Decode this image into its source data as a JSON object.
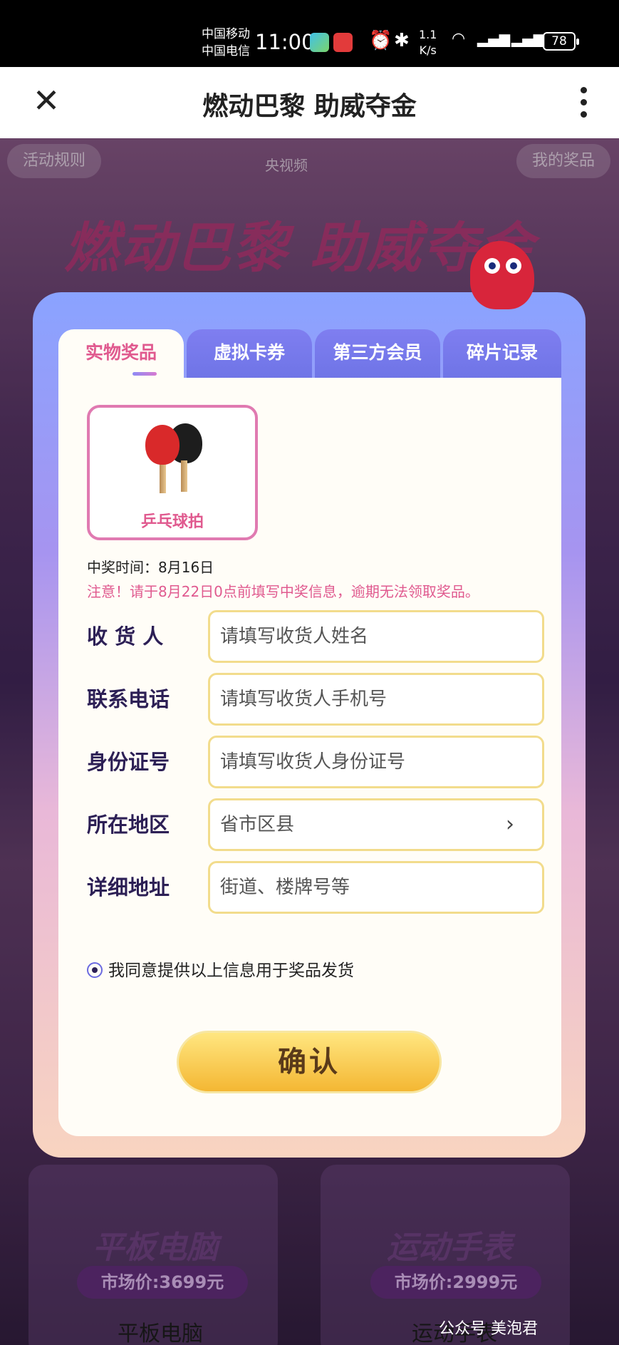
{
  "status_bar": {
    "carrier_1": "中国移动",
    "carrier_2": "中国电信",
    "time": "11:00",
    "net_speed_value": "1.1",
    "net_speed_unit": "K/s",
    "battery": "78",
    "icons": [
      "alarm-icon",
      "bluetooth-icon",
      "wifi-icon",
      "signal-icon"
    ]
  },
  "title_bar": {
    "title": "燃动巴黎 助威夺金"
  },
  "background": {
    "rules_link": "活动规则",
    "my_prizes_link": "我的奖品",
    "logo_text": "央视频",
    "headline": "燃动巴黎 助威夺金",
    "items": [
      {
        "name": "平板电脑",
        "price": "市场价:3699元",
        "caption": "平板电脑"
      },
      {
        "name": "运动手表",
        "price": "市场价:2999元",
        "caption": "运动手表"
      }
    ]
  },
  "modal": {
    "tabs": [
      {
        "label": "实物奖品",
        "active": true
      },
      {
        "label": "虚拟卡券",
        "active": false
      },
      {
        "label": "第三方会员",
        "active": false
      },
      {
        "label": "碎片记录",
        "active": false
      }
    ],
    "prize": {
      "name": "乒乓球拍"
    },
    "win_time": "中奖时间：8月16日",
    "notice": "注意！请于8月22日0点前填写中奖信息，逾期无法领取奖品。",
    "form": {
      "recipient_label": "收 货 人",
      "recipient_placeholder": "请填写收货人姓名",
      "phone_label": "联系电话",
      "phone_placeholder": "请填写收货人手机号",
      "id_label": "身份证号",
      "id_placeholder": "请填写收货人身份证号",
      "region_label": "所在地区",
      "region_placeholder": "省市区县",
      "address_label": "详细地址",
      "address_placeholder": "街道、楼牌号等"
    },
    "agree_text": "我同意提供以上信息用于奖品发货",
    "confirm_label": "确认"
  },
  "watermark": "公众号 美泡君"
}
